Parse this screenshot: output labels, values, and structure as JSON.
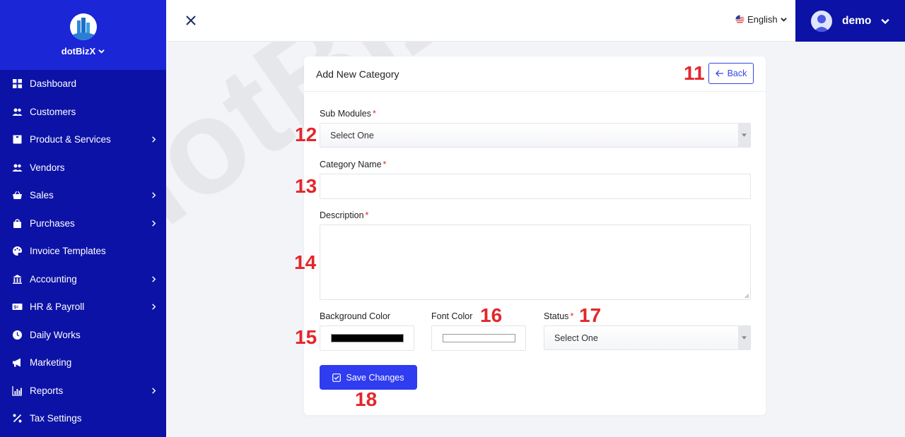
{
  "app": {
    "brand_name": "dotBizX",
    "language": "English",
    "user_name": "demo"
  },
  "sidebar": {
    "items": [
      {
        "label": "Dashboard",
        "icon": "grid-icon",
        "has_submenu": false
      },
      {
        "label": "Customers",
        "icon": "users-icon",
        "has_submenu": false
      },
      {
        "label": "Product & Services",
        "icon": "box-icon",
        "has_submenu": true
      },
      {
        "label": "Vendors",
        "icon": "users-icon",
        "has_submenu": false
      },
      {
        "label": "Sales",
        "icon": "basket-icon",
        "has_submenu": true
      },
      {
        "label": "Purchases",
        "icon": "bag-icon",
        "has_submenu": true
      },
      {
        "label": "Invoice Templates",
        "icon": "palette-icon",
        "has_submenu": false
      },
      {
        "label": "Accounting",
        "icon": "bank-icon",
        "has_submenu": true
      },
      {
        "label": "HR & Payroll",
        "icon": "money-icon",
        "has_submenu": true
      },
      {
        "label": "Daily Works",
        "icon": "clock-icon",
        "has_submenu": false
      },
      {
        "label": "Marketing",
        "icon": "megaphone-icon",
        "has_submenu": false
      },
      {
        "label": "Reports",
        "icon": "bar-chart-icon",
        "has_submenu": true
      },
      {
        "label": "Tax Settings",
        "icon": "percent-icon",
        "has_submenu": false
      }
    ]
  },
  "form": {
    "title": "Add New Category",
    "back_label": "Back",
    "sub_modules_label": "Sub Modules",
    "sub_modules_value": "Select One",
    "category_name_label": "Category Name",
    "category_name_value": "",
    "description_label": "Description",
    "description_value": "",
    "bg_color_label": "Background Color",
    "bg_color_value": "#000000",
    "font_color_label": "Font Color",
    "font_color_value": "#ffffff",
    "status_label": "Status",
    "status_value": "Select One",
    "required_mark": "*",
    "save_label": "Save Changes"
  },
  "annotations": [
    "11",
    "12",
    "13",
    "14",
    "15",
    "16",
    "17",
    "18"
  ],
  "watermark": "dotBizX.Com",
  "colors": {
    "sidebar_bg": "#0d12a6",
    "brand_bg": "#1b26d6",
    "primary": "#2f3cf0",
    "annotation": "#e3262c"
  }
}
